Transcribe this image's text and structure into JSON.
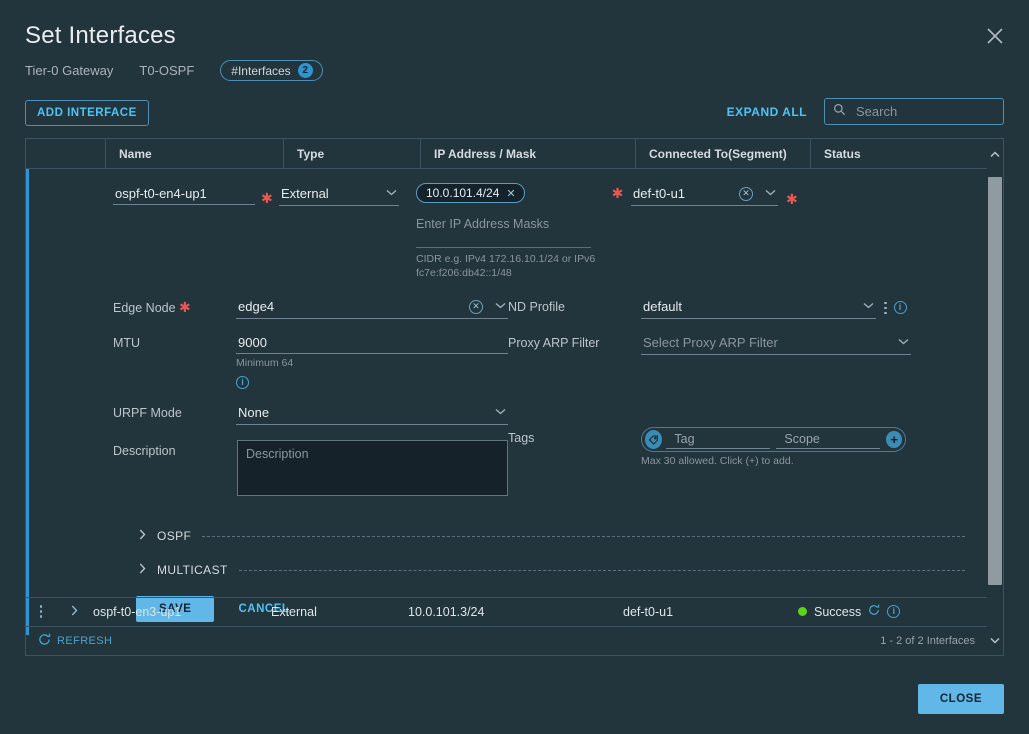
{
  "dialog": {
    "title": "Set Interfaces",
    "close_icon": "close-icon",
    "close_button_label": "CLOSE"
  },
  "breadcrumb": {
    "gateway_type": "Tier-0 Gateway",
    "gateway_name": "T0-OSPF",
    "chip_label": "#Interfaces",
    "chip_count": "2"
  },
  "toolbar": {
    "add_interface_label": "ADD INTERFACE",
    "expand_all_label": "EXPAND ALL",
    "search_placeholder": "Search",
    "search_value": "",
    "search_icon": "search-icon"
  },
  "table": {
    "columns": [
      "",
      "Name",
      "Type",
      "IP Address / Mask",
      "Connected To(Segment)",
      "Status"
    ],
    "rows": [
      {
        "name": "ospf-t0-en3-up1",
        "type": "External",
        "ip": "10.0.101.3/24",
        "connected_to": "def-t0-u1",
        "status": "Success"
      }
    ],
    "footer": {
      "refresh_label": "REFRESH",
      "count": "1 - 2 of 2 Interfaces"
    }
  },
  "editor": {
    "name_value": "ospf-t0-en4-up1",
    "type_value": "External",
    "ip_chip": "10.0.101.4/24",
    "ip_placeholder": "Enter IP Address Masks",
    "ip_hint": "CIDR e.g. IPv4 172.16.10.1/24 or IPv6 fc7e:f206:db42::1/48",
    "connected_to_value": "def-t0-u1",
    "left_fields": {
      "edge_node_label": "Edge Node",
      "edge_node_value": "edge4",
      "mtu_label": "MTU",
      "mtu_value": "9000",
      "mtu_help": "Minimum 64",
      "urpf_label": "URPF Mode",
      "urpf_value": "None",
      "description_label": "Description",
      "description_placeholder": "Description",
      "description_value": ""
    },
    "right_fields": {
      "nd_profile_label": "ND Profile",
      "nd_profile_value": "default",
      "proxy_arp_label": "Proxy ARP Filter",
      "proxy_arp_placeholder": "Select Proxy ARP Filter",
      "tags_label": "Tags",
      "tag_placeholder": "Tag",
      "scope_placeholder": "Scope",
      "tags_help": "Max 30 allowed. Click (+) to add."
    },
    "accordions": [
      {
        "label": "OSPF"
      },
      {
        "label": "MULTICAST"
      }
    ],
    "save_label": "SAVE",
    "cancel_label": "CANCEL"
  },
  "colors": {
    "background": "#22343c",
    "accent": "#4dc4f5",
    "primary_button": "#61b7e8",
    "required_star": "#e8584f",
    "status_success": "#5ed419",
    "selected_row_border": "#2f94d3"
  }
}
